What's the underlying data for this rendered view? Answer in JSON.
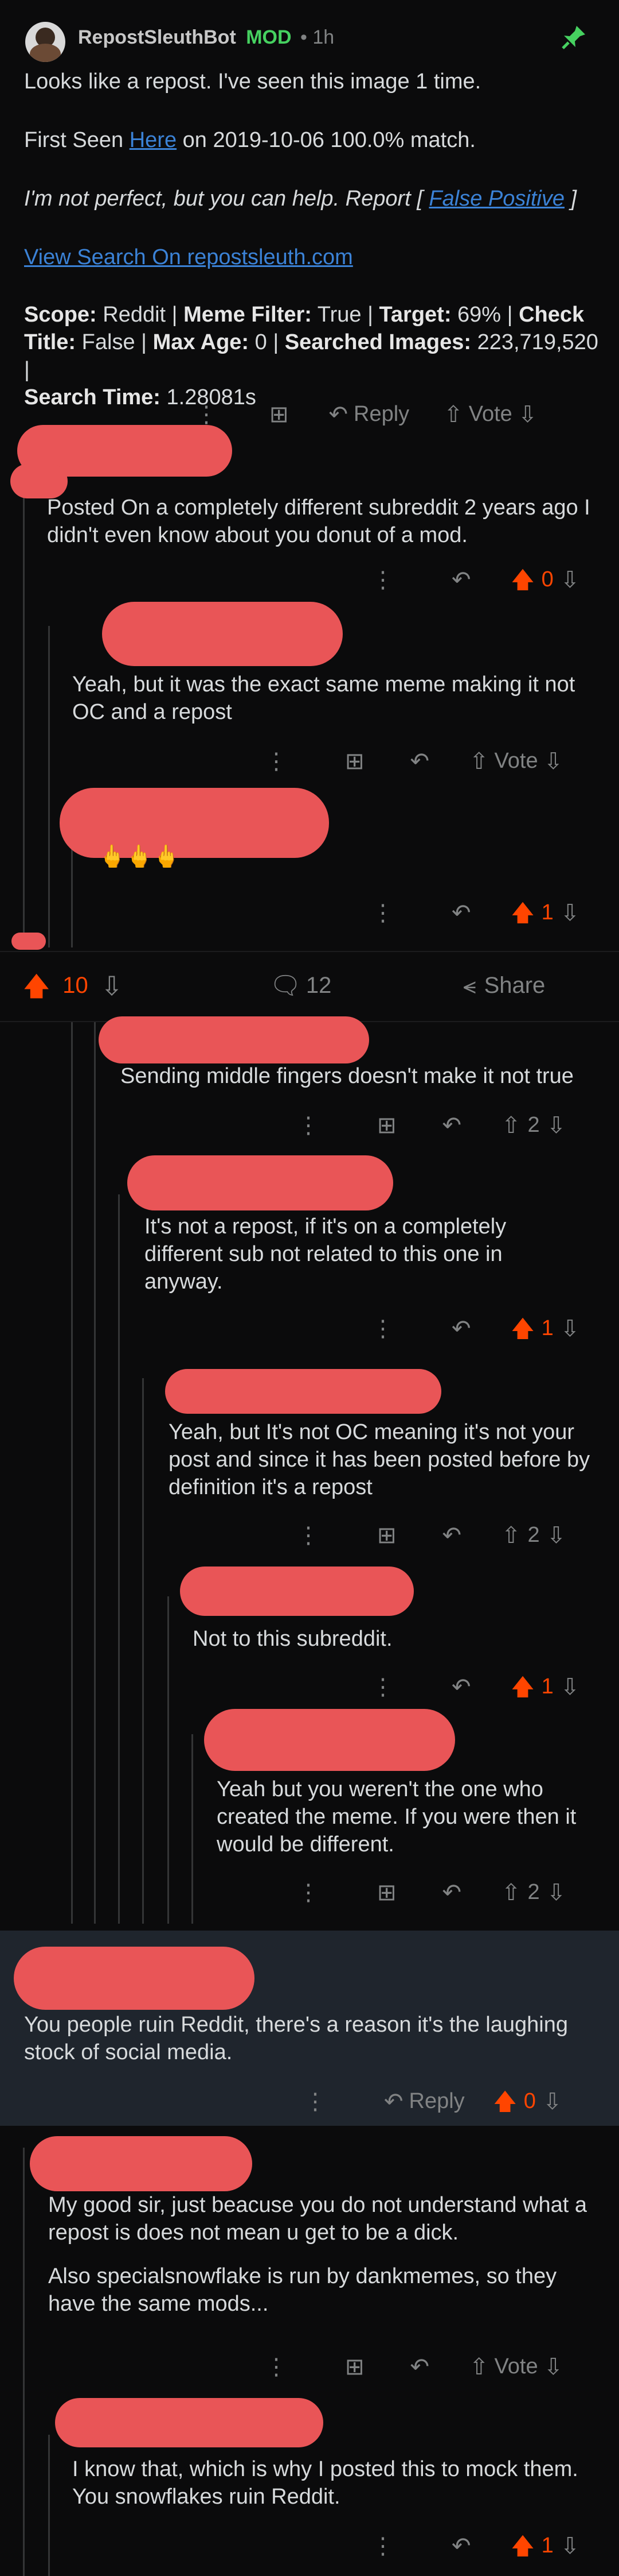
{
  "bot": {
    "username": "RepostSleuthBot",
    "mod_badge": "MOD",
    "age": "• 1h",
    "line1": "Looks like a repost. I've seen this image 1 time.",
    "first_seen_prefix": "First Seen ",
    "first_seen_link": "Here",
    "first_seen_suffix": " on 2019-10-06 100.0% match.",
    "not_perfect": "I'm not perfect, but you can help. Report [ ",
    "false_positive": "False Positive",
    "bracket_close": " ]",
    "view_search": "View Search On repostsleuth.com",
    "scope_label": "Scope:",
    "scope_val": " Reddit | ",
    "meme_label": "Meme Filter:",
    "meme_val": " True | ",
    "target_label": "Target:",
    "target_val": " 69% | ",
    "check_label": "Check",
    "title_label": "Title:",
    "title_val": " False | ",
    "maxage_label": "Max Age:",
    "maxage_val": " 0 | ",
    "searched_label": "Searched Images:",
    "searched_val": " 223,719,520 |",
    "searchtime_label": "Search Time:",
    "searchtime_val": " 1.28081s",
    "reply": "Reply",
    "vote": "Vote"
  },
  "comments": {
    "c1": "Posted On a completely different subreddit 2 years ago I didn't even know about you donut of a mod.",
    "c1_score": "0",
    "c2": "Yeah, but it was the exact same meme making it not OC and a repost",
    "c2_vote": "Vote",
    "c3_emoji": "🖕🖕🖕",
    "c3_score": "1",
    "c4": "Sending middle fingers doesn't make it not true",
    "c4_score": "2",
    "c5": "It's not a repost, if it's on a completely different sub not related to this one in anyway.",
    "c5_score": "1",
    "c6": "Yeah, but It's not OC meaning it's not your post and since it has been posted before by definition it's a repost",
    "c6_score": "2",
    "c7": "Not to this subreddit.",
    "c7_score": "1",
    "c8": "Yeah but you weren't the one who created the meme. If you were then it would be different.",
    "c8_score": "2",
    "c9": "You people ruin Reddit, there's a reason it's the laughing stock of social media.",
    "c9_reply": "Reply",
    "c9_score": "0",
    "c10a": "My good sir, just beacuse you do not understand what a repost is does not mean u get to be a dick.",
    "c10b": "Also specialsnowflake is run by dankmemes, so they have the same mods...",
    "c10_vote": "Vote",
    "c11": "I know that, which is why I posted this to mock them. You snowflakes ruin Reddit.",
    "c11_score": "1"
  },
  "post_bar": {
    "score": "10",
    "comments": "12",
    "share": "Share"
  },
  "colors": {
    "accent": "#ff4500",
    "mod": "#46d160",
    "link": "#3b82d6"
  }
}
